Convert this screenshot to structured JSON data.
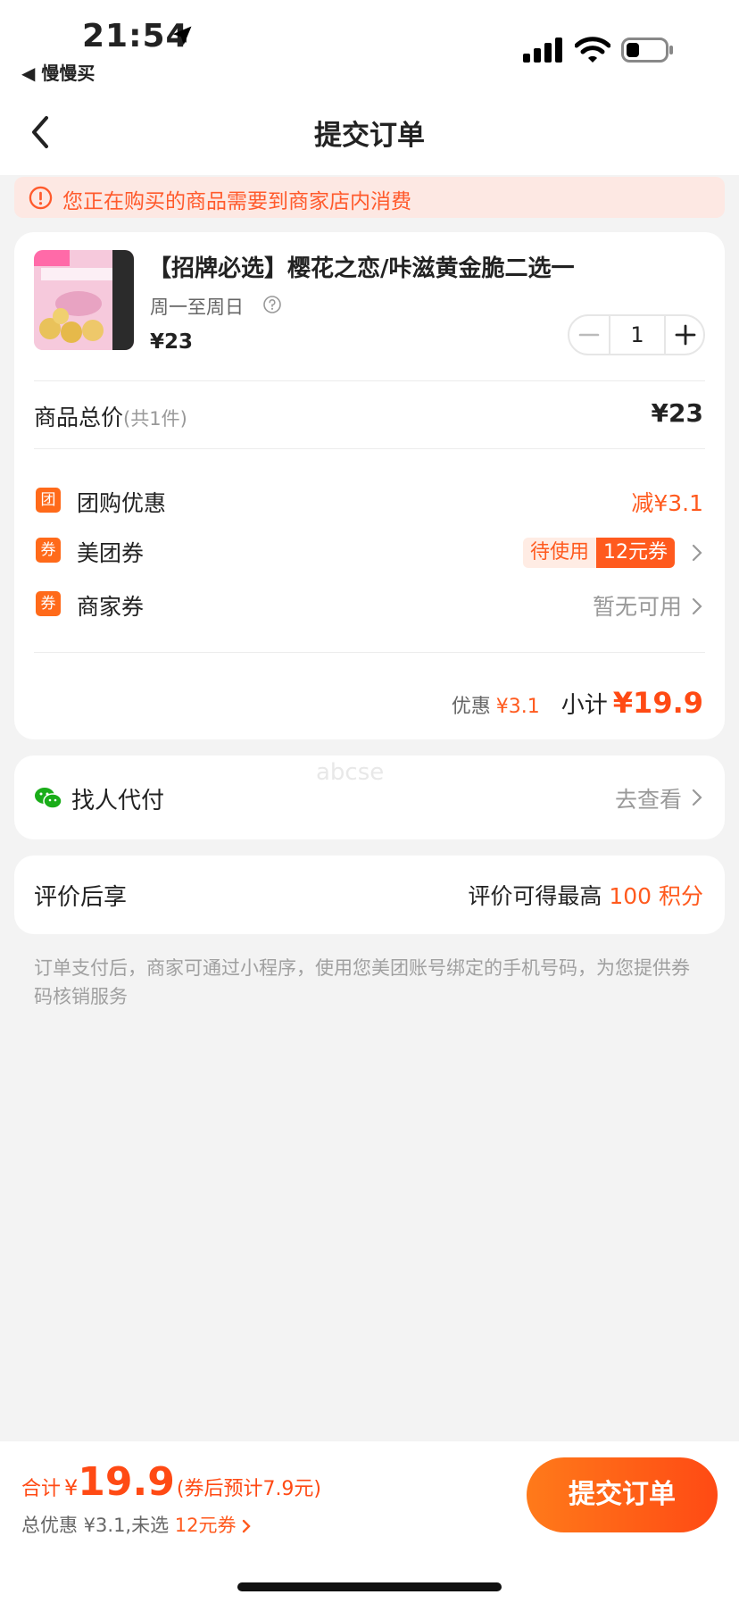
{
  "status_bar": {
    "time": "21:54",
    "back_app": "◀ 慢慢买"
  },
  "nav": {
    "title": "提交订单"
  },
  "alert": {
    "text": "您正在购买的商品需要到商家店内消费"
  },
  "product": {
    "title": "【招牌必选】樱花之恋/咔滋黄金脆二选一",
    "schedule": "周一至周日",
    "price": "¥23",
    "quantity": "1"
  },
  "summary": {
    "total_label": "商品总价",
    "total_count": "(共1件)",
    "total_value": "¥23",
    "rows": [
      {
        "icon": "团",
        "label": "团购优惠",
        "value": "减¥3.1"
      },
      {
        "icon": "券",
        "label": "美团券",
        "tag_left": "待使用",
        "tag_right": "12元券"
      },
      {
        "icon": "券",
        "label": "商家券",
        "value": "暂无可用"
      }
    ],
    "discount_label": "优惠",
    "discount_value": "¥3.1",
    "subtotal_label": "小计",
    "subtotal_value": "¥19.9"
  },
  "pay_for_me": {
    "label": "找人代付",
    "action": "去查看",
    "watermark": "abcse"
  },
  "review": {
    "label": "评价后享",
    "right_prefix": "评价可得最高",
    "right_value": "100 积分"
  },
  "notice": "订单支付后，商家可通过小程序，使用您美团账号绑定的手机号码，为您提供券码核销服务",
  "bottom": {
    "total_label": "合计",
    "yen": "¥",
    "total_value": "19.9",
    "after_coupon": "(券后预计7.9元)",
    "discount_text": "总优惠 ¥3.1,未选",
    "coupon_link": "12元券",
    "submit_label": "提交订单"
  },
  "colors": {
    "accent": "#ff5a1e",
    "alert_bg": "#fde8e3",
    "wechat": "#1aad19"
  }
}
